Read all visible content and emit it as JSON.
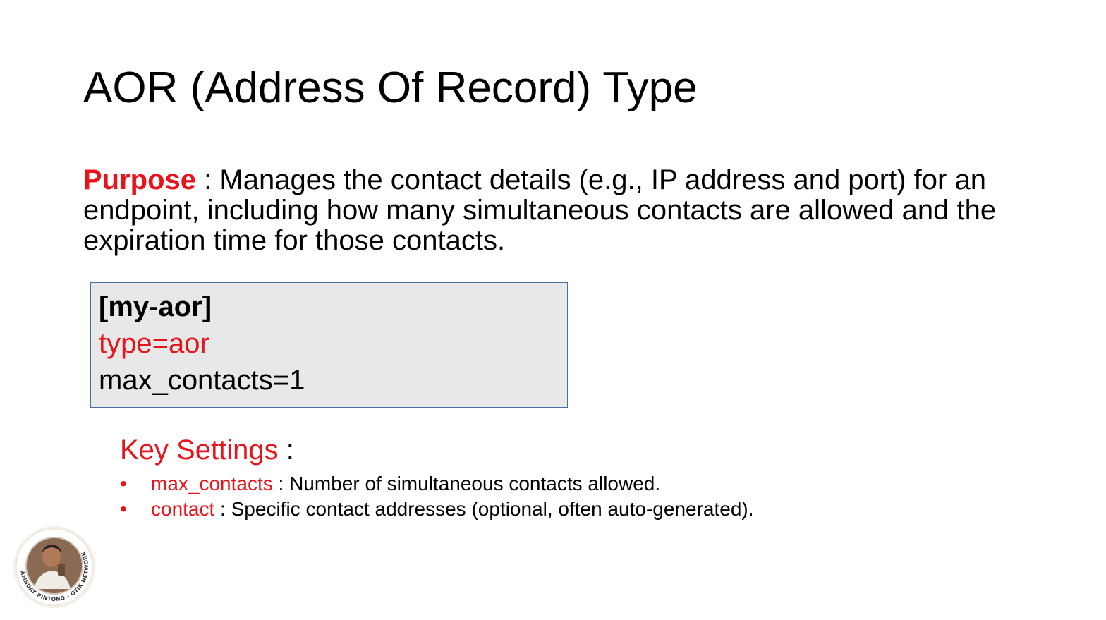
{
  "title": "AOR (Address Of Record) Type",
  "purpose": {
    "label": "Purpose",
    "text": " : Manages the contact details (e.g., IP address and port) for an endpoint, including how many simultaneous contacts are allowed and the expiration time for those contacts."
  },
  "config": {
    "section": "[my-aor]",
    "type_line": "type=aor",
    "max_line": "max_contacts=1"
  },
  "key_settings": {
    "title": "Key Settings",
    "colon": " :",
    "items": [
      {
        "term": "max_contacts",
        "desc": " : Number of simultaneous contacts allowed."
      },
      {
        "term": "contact",
        "desc": " : Specific contact addresses (optional, often auto-generated)."
      }
    ]
  },
  "logo": {
    "ring_text": "AMNUAY PINTONG - OTIK NETWORK"
  },
  "colors": {
    "accent": "#e8141c",
    "box_bg": "#e8e8e8",
    "box_border": "#41719c"
  }
}
